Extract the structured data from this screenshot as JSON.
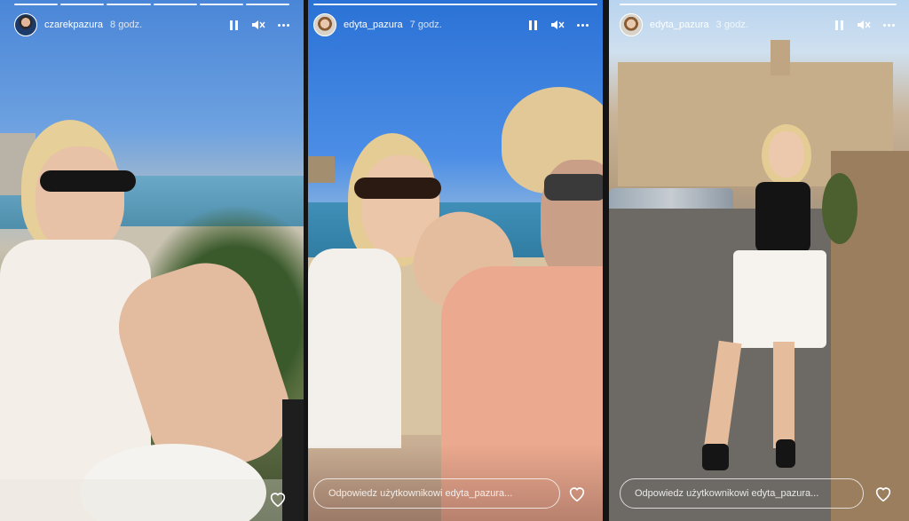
{
  "stories": [
    {
      "username": "czarekpazura",
      "time": "8 godz.",
      "progress": [
        1,
        1,
        1,
        1,
        1,
        1
      ],
      "has_reply": false
    },
    {
      "username": "edyta_pazura",
      "time": "7 godz.",
      "reply_placeholder": "Odpowiedz użytkownikowi edyta_pazura...",
      "has_reply": true
    },
    {
      "username": "edyta_pazura",
      "time": "3 godz.",
      "reply_placeholder": "Odpowiedz użytkownikowi edyta_pazura...",
      "has_reply": true
    }
  ],
  "icons": {
    "pause": "pause-icon",
    "mute": "speaker-muted-icon",
    "more": "more-options-icon",
    "like": "heart-icon"
  }
}
